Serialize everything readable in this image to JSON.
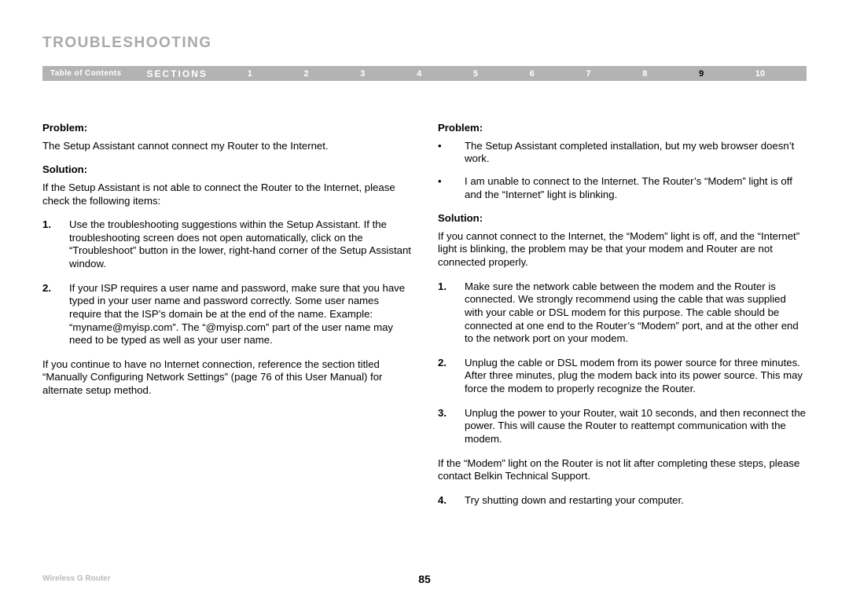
{
  "header": {
    "title": "TROUBLESHOOTING",
    "toc": "Table of Contents",
    "sections_label": "SECTIONS",
    "sections": [
      "1",
      "2",
      "3",
      "4",
      "5",
      "6",
      "7",
      "8",
      "9",
      "10"
    ],
    "current_section_index": 8
  },
  "left": {
    "problem_heading": "Problem:",
    "problem_text": "The Setup Assistant cannot connect my Router to the Internet.",
    "solution_heading": "Solution:",
    "solution_intro": "If the Setup Assistant is not able to connect the Router to the Internet, please check the following items:",
    "steps": [
      {
        "n": "1.",
        "t": "Use the troubleshooting suggestions within the Setup Assistant. If the troubleshooting screen does not open automatically, click on the “Troubleshoot” button in the lower, right-hand corner of the Setup Assistant window."
      },
      {
        "n": "2.",
        "t": "If your ISP requires a user name and password, make sure that you have typed in your user name and password correctly. Some user names require that the ISP’s domain be at the end of the name. Example: “myname@myisp.com”. The “@myisp.com” part of the user name may need to be typed as well as your user name."
      }
    ],
    "closing": "If you continue to have no Internet connection, reference the section titled “Manually Configuring Network Settings” (page 76 of this User Manual) for alternate setup method."
  },
  "right": {
    "problem_heading": "Problem:",
    "problem_bullets": [
      "The Setup Assistant completed installation, but my web browser doesn’t work.",
      "I am unable to connect to the Internet. The Router’s “Modem” light is off and the “Internet” light is blinking."
    ],
    "solution_heading": "Solution:",
    "solution_intro": "If you cannot connect to the Internet, the “Modem” light is off, and the “Internet” light is blinking, the problem may be that your modem and Router are not connected properly.",
    "steps": [
      {
        "n": "1.",
        "t": "Make sure the network cable between the modem and the Router is connected. We strongly recommend using the cable that was supplied with your cable or DSL modem for this purpose. The cable should be connected at one end to the Router’s “Modem” port, and at the other end to the network port on your modem."
      },
      {
        "n": "2.",
        "t": "Unplug the cable or DSL modem from its power source for three minutes. After three minutes, plug the modem back into its power source. This may force the modem to properly recognize the Router."
      },
      {
        "n": "3.",
        "t": "Unplug the power to your Router, wait 10 seconds, and then reconnect the power. This will cause the Router to reattempt communication with the modem."
      }
    ],
    "mid_note": "If the “Modem” light on the Router is not lit after completing these steps, please contact Belkin Technical Support.",
    "steps_after": [
      {
        "n": "4.",
        "t": "Try shutting down and restarting your computer."
      }
    ]
  },
  "footer": {
    "product": "Wireless G Router",
    "page_number": "85"
  }
}
